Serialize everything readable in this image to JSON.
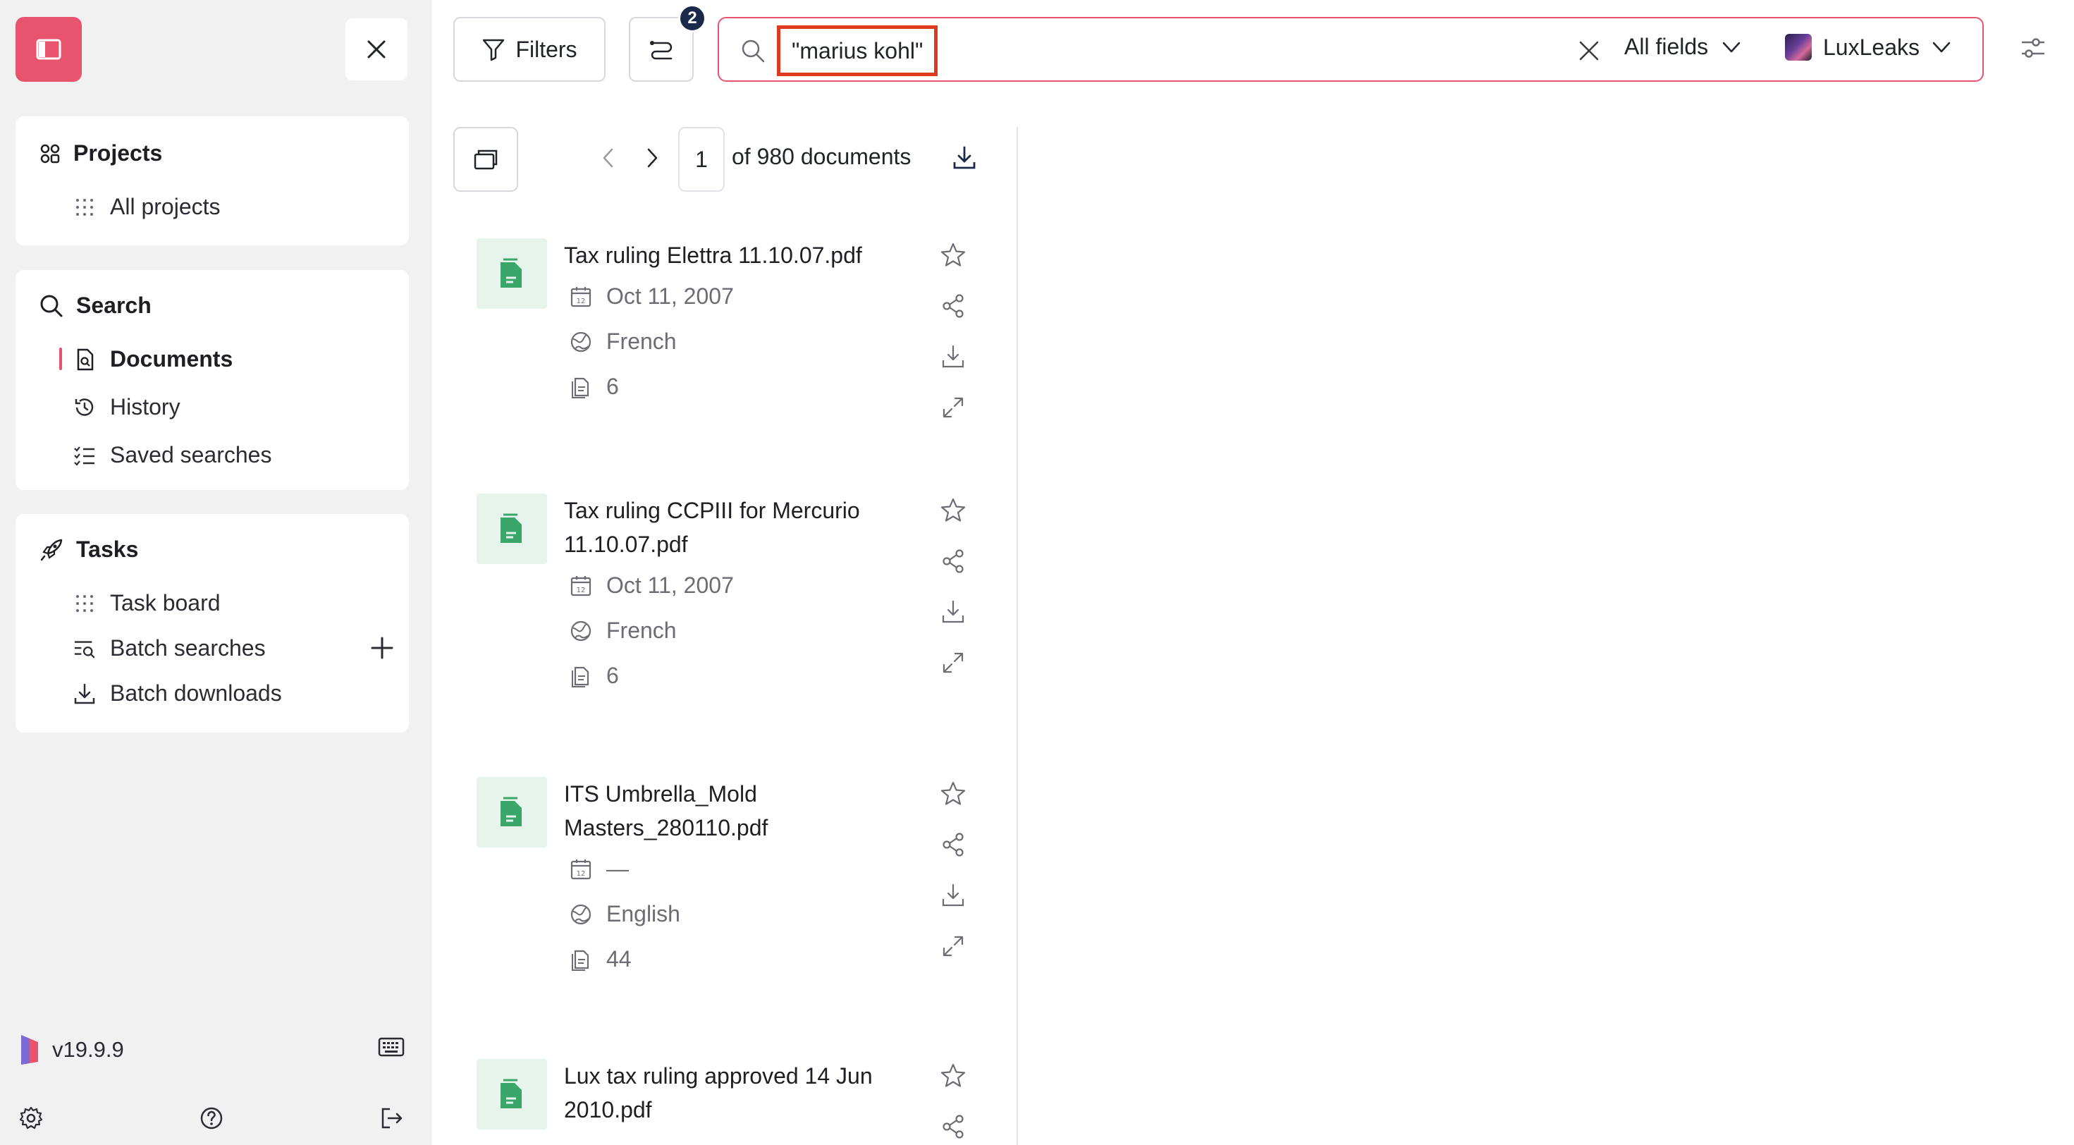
{
  "sidebar": {
    "projects": {
      "title": "Projects",
      "items": [
        {
          "label": "All projects"
        }
      ]
    },
    "search": {
      "title": "Search",
      "items": [
        {
          "label": "Documents",
          "active": true
        },
        {
          "label": "History"
        },
        {
          "label": "Saved searches"
        }
      ]
    },
    "tasks": {
      "title": "Tasks",
      "items": [
        {
          "label": "Task board"
        },
        {
          "label": "Batch searches"
        },
        {
          "label": "Batch downloads"
        }
      ]
    },
    "version": "v19.9.9"
  },
  "toolbar": {
    "filters_label": "Filters",
    "history_badge": "2",
    "search_query": "\"marius kohl\"",
    "field_select": "All fields",
    "project_select": "LuxLeaks"
  },
  "pager": {
    "current_page": "1",
    "total_label": "of 980 documents"
  },
  "documents": [
    {
      "title": "Tax ruling Elettra 11.10.07.pdf",
      "date": "Oct 11, 2007",
      "language": "French",
      "pages": "6"
    },
    {
      "title": "Tax ruling CCPIII for Mercurio 11.10.07.pdf",
      "date": "Oct 11, 2007",
      "language": "French",
      "pages": "6"
    },
    {
      "title": "ITS Umbrella_Mold Masters_280110.pdf",
      "date": "—",
      "language": "English",
      "pages": "44"
    },
    {
      "title": "Lux tax ruling approved 14 Jun 2010.pdf",
      "date": "",
      "language": "",
      "pages": ""
    }
  ],
  "colors": {
    "accent": "#e8536e",
    "highlight_box": "#e03a1e",
    "doc_thumb_bg": "#e6f4ec",
    "doc_icon": "#3aa66a",
    "badge_bg": "#1b2a4a"
  }
}
